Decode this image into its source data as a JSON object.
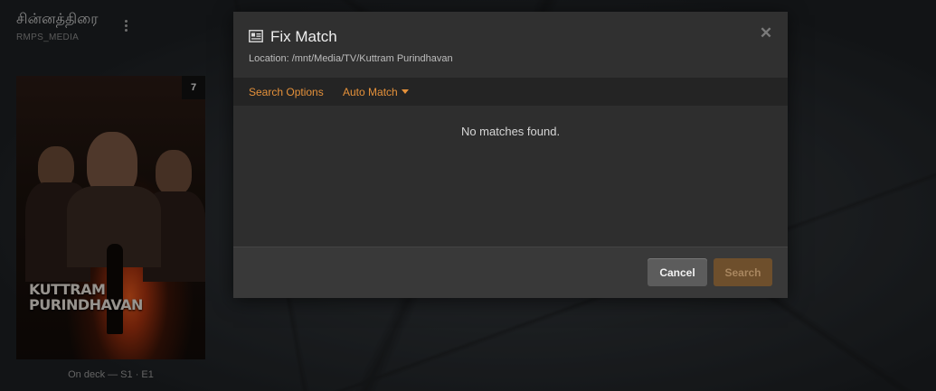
{
  "library": {
    "title": "சின்னத்திரை",
    "server": "RMPS_MEDIA"
  },
  "poster": {
    "title_line1": "KUTTRAM",
    "title_line2": "PURINDHAVAN",
    "badge": "7",
    "caption": "On deck — S1 · E1"
  },
  "modal": {
    "title": "Fix Match",
    "location": "Location: /mnt/Media/TV/Kuttram Purindhavan",
    "close_glyph": "✕",
    "tabs": [
      {
        "label": "Search Options"
      },
      {
        "label": "Auto Match"
      }
    ],
    "message": "No matches found.",
    "buttons": {
      "cancel": "Cancel",
      "search": "Search"
    }
  },
  "colors": {
    "accent": "#e5913a",
    "modal_bg": "#2f2f2f",
    "footer_bg": "#393939"
  }
}
